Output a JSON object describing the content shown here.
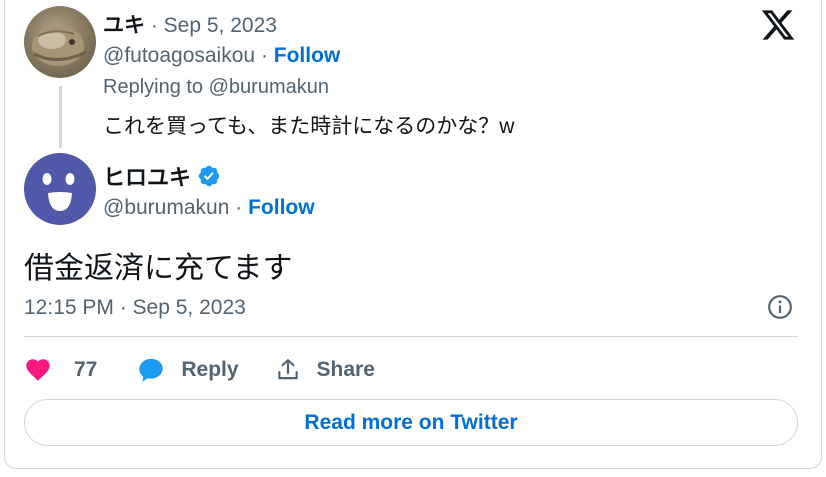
{
  "reply_tweet": {
    "author_name": "ユキ",
    "date": "· Sep 5, 2023",
    "handle": "@futoagosaikou",
    "separator": "·",
    "follow_label": "Follow",
    "replying_to": "Replying to @burumakun",
    "text": "これを買っても、また時計になるのかな？w"
  },
  "main_tweet": {
    "author_name": "ヒロユキ",
    "verified": true,
    "handle": "@burumakun",
    "separator": "·",
    "follow_label": "Follow",
    "text": "借金返済に充てます",
    "timestamp": "12:15 PM · Sep 5, 2023"
  },
  "actions": {
    "like_count": "77",
    "reply_label": "Reply",
    "share_label": "Share"
  },
  "read_more_label": "Read more on Twitter",
  "icons": [
    "x-logo-icon",
    "verified-badge-icon",
    "info-icon",
    "heart-icon",
    "reply-bubble-icon",
    "share-icon"
  ],
  "colors": {
    "follow": "#006fd6",
    "verified": "#1d9bf0",
    "heart": "#f91880",
    "secondary_text": "#536471",
    "avatar_main": "#5058a9"
  }
}
